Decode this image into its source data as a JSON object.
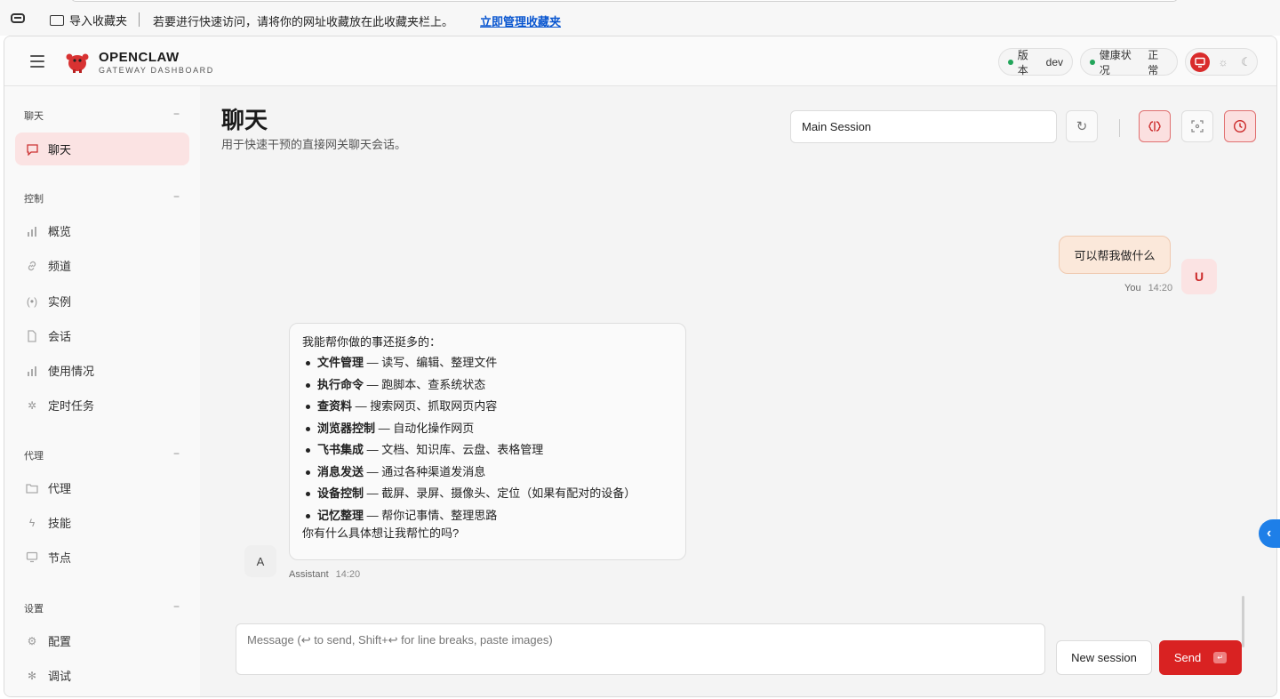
{
  "bookmarks": {
    "import_label": "导入收藏夹",
    "hint": "若要进行快速访问，请将你的网址收藏放在此收藏夹栏上。",
    "manage_link": "立即管理收藏夹"
  },
  "header": {
    "brand_name": "OPENCLAW",
    "brand_sub": "GATEWAY DASHBOARD",
    "version_label": "版本",
    "version_value": "dev",
    "health_label": "健康状况",
    "health_value": "正常"
  },
  "sidebar": {
    "sections": [
      {
        "title": "聊天",
        "items": [
          "聊天"
        ]
      },
      {
        "title": "控制",
        "items": [
          "概览",
          "频道",
          "实例",
          "会话",
          "使用情况",
          "定时任务"
        ]
      },
      {
        "title": "代理",
        "items": [
          "代理",
          "技能",
          "节点"
        ]
      },
      {
        "title": "设置",
        "items": [
          "配置",
          "调试"
        ]
      }
    ],
    "collapse_glyph": "−"
  },
  "main": {
    "title": "聊天",
    "subtitle": "用于快速干预的直接网关聊天会话。",
    "session_value": "Main Session"
  },
  "chat": {
    "user_message": "可以帮我做什么",
    "user_name": "You",
    "user_time": "14:20",
    "user_avatar": "U",
    "assistant_intro": "我能帮你做的事还挺多的：",
    "assistant_items": [
      {
        "bold": "文件管理",
        "rest": " — 读写、编辑、整理文件"
      },
      {
        "bold": "执行命令",
        "rest": " — 跑脚本、查系统状态"
      },
      {
        "bold": "查资料",
        "rest": " — 搜索网页、抓取网页内容"
      },
      {
        "bold": "浏览器控制",
        "rest": " — 自动化操作网页"
      },
      {
        "bold": "飞书集成",
        "rest": " — 文档、知识库、云盘、表格管理"
      },
      {
        "bold": "消息发送",
        "rest": " — 通过各种渠道发消息"
      },
      {
        "bold": "设备控制",
        "rest": " — 截屏、录屏、摄像头、定位（如果有配对的设备）"
      },
      {
        "bold": "记忆整理",
        "rest": " — 帮你记事情、整理思路"
      }
    ],
    "assistant_outro": "你有什么具体想让我帮忙的吗?",
    "assistant_name": "Assistant",
    "assistant_time": "14:20",
    "assistant_avatar": "A"
  },
  "composer": {
    "placeholder": "Message (↩ to send, Shift+↩ for line breaks, paste images)",
    "new_session_label": "New session",
    "send_label": "Send",
    "send_kbd": "↵"
  },
  "colors": {
    "accent": "#d92222",
    "accent_soft": "#fbe3e3",
    "status_ok": "#22a55a",
    "user_bubble": "#fbe8da",
    "edge_tab": "#1e7fe8"
  }
}
